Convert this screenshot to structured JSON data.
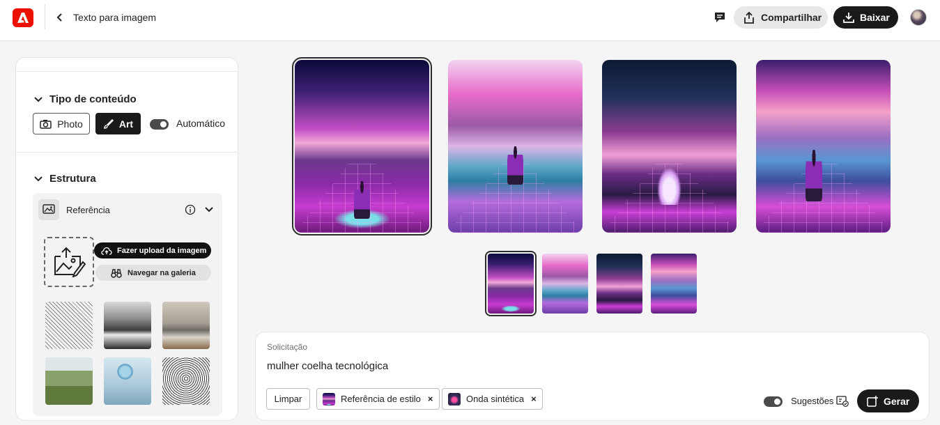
{
  "header": {
    "title": "Texto para imagem",
    "share_label": "Compartilhar",
    "download_label": "Baixar"
  },
  "panel": {
    "content_type": {
      "title": "Tipo de conteúdo",
      "photo_label": "Photo",
      "art_label": "Art",
      "auto_label": "Automático",
      "auto_on": true,
      "selected": "Art"
    },
    "structure": {
      "title": "Estrutura",
      "reference_label": "Referência",
      "upload_label": "Fazer upload da imagem",
      "gallery_label": "Navegar na galeria"
    }
  },
  "main": {
    "images": [
      {
        "name": "generated-image-1",
        "selected": true
      },
      {
        "name": "generated-image-2",
        "selected": false
      },
      {
        "name": "generated-image-3",
        "selected": false
      },
      {
        "name": "generated-image-4",
        "selected": false
      }
    ]
  },
  "prompt": {
    "label": "Solicitação",
    "text": "mulher coelha tecnológica",
    "clear_label": "Limpar",
    "chips": [
      {
        "label": "Referência de estilo"
      },
      {
        "label": "Onda sintética"
      }
    ],
    "suggestions_label": "Sugestões",
    "suggestions_on": true,
    "generate_label": "Gerar"
  },
  "colors": {
    "brand": "#eb1000",
    "dark": "#1a1a1a",
    "panel_bg": "#ffffff",
    "page_bg": "#f5f5f5"
  }
}
